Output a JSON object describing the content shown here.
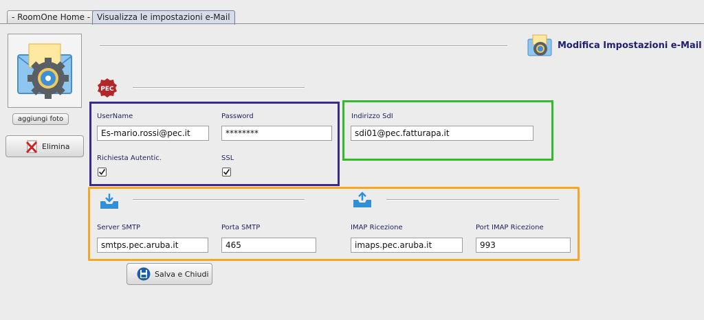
{
  "tabs": [
    {
      "label": "- RoomOne Home -",
      "active": false
    },
    {
      "label": "Visualizza le impostazioni e-Mail",
      "active": true
    }
  ],
  "header": {
    "title": "Modifica Impostazioni e-Mail",
    "icon": "email-settings-icon"
  },
  "left_panel": {
    "add_photo_label": "aggiungi foto",
    "delete_label": "Elimina"
  },
  "pec_badge": "PEC",
  "credentials": {
    "username_label": "UserName",
    "username_value": "Es-mario.rossi@pec.it",
    "password_label": "Password",
    "password_value": "********",
    "auth_label": "Richiesta Autentic.",
    "auth_checked": true,
    "ssl_label": "SSL",
    "ssl_checked": true
  },
  "sdi": {
    "label": "Indirizzo SdI",
    "value": "sdi01@pec.fatturapa.it"
  },
  "servers": {
    "smtp_server_label": "Server SMTP",
    "smtp_server_value": "smtps.pec.aruba.it",
    "smtp_port_label": "Porta SMTP",
    "smtp_port_value": "465",
    "imap_label": "IMAP Ricezione",
    "imap_value": "imaps.pec.aruba.it",
    "imap_port_label": "Port IMAP Ricezione",
    "imap_port_value": "993"
  },
  "save_label": "Salva e Chiudi",
  "colors": {
    "credentials_border": "#3a2892",
    "sdi_border": "#35b82c",
    "servers_border": "#f3a727",
    "label_text": "#1f1f5e"
  }
}
